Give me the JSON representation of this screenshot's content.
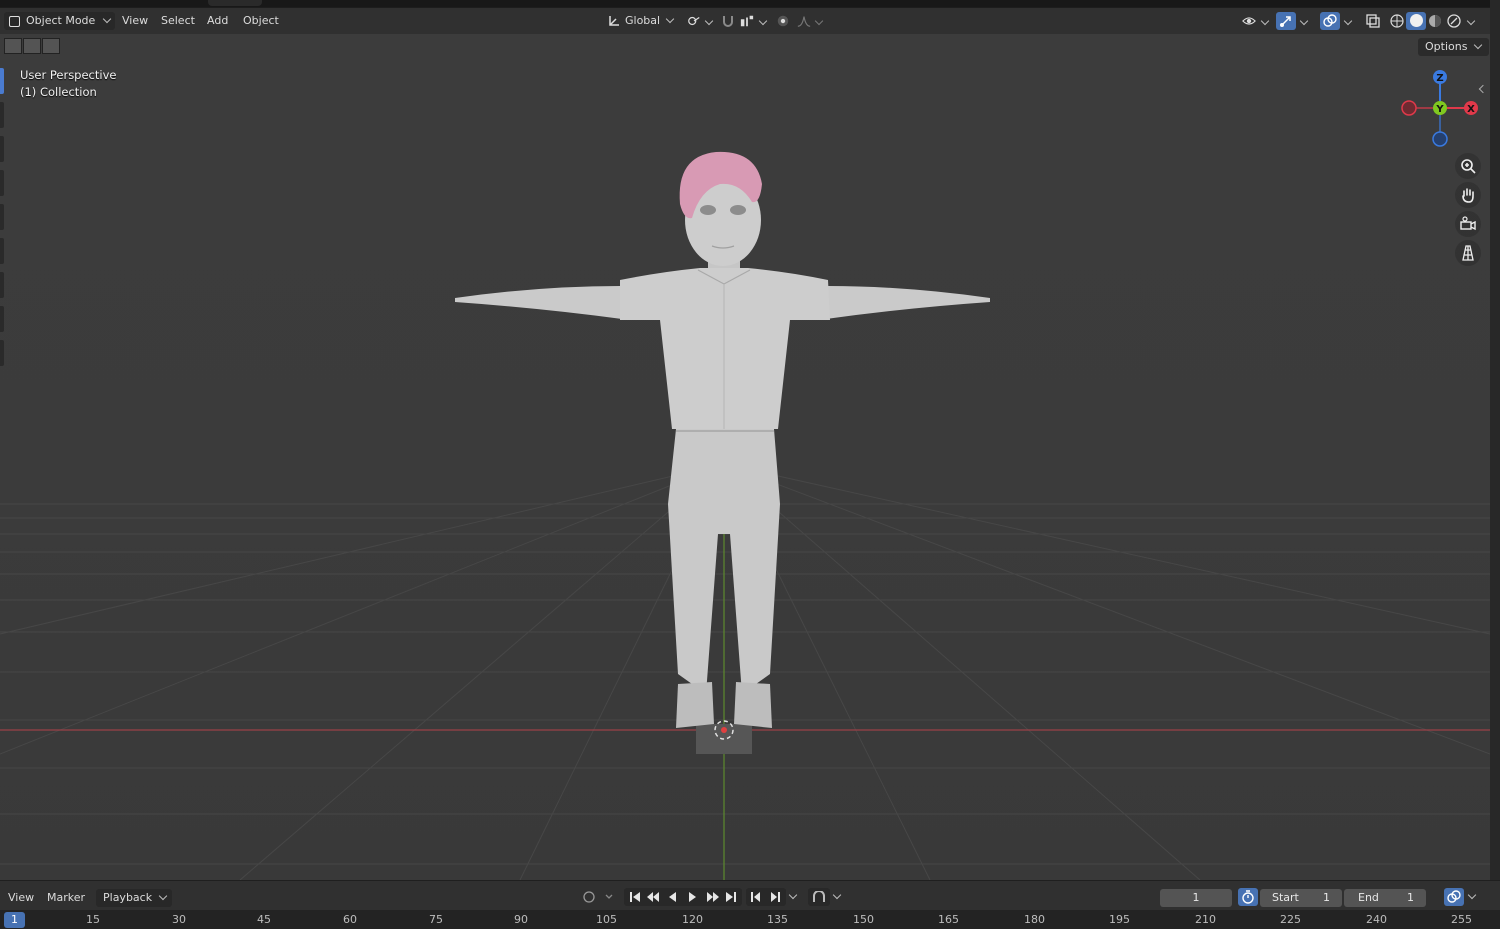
{
  "viewport_header": {
    "mode_label": "Object Mode",
    "menu": [
      "View",
      "Select",
      "Add",
      "Object"
    ],
    "transform_orientation": "Global"
  },
  "viewport": {
    "perspective_label": "User Perspective",
    "collection_label": "(1) Collection",
    "options_label": "Options",
    "gizmo_axes": {
      "x": "X",
      "y": "Y",
      "z": "Z"
    }
  },
  "timeline": {
    "menu": [
      "View",
      "Marker",
      "Playback"
    ],
    "current_frame": "1",
    "start_label": "Start",
    "start_value": "1",
    "end_label": "End",
    "end_value": "1",
    "ruler_current": "1",
    "ruler_ticks": [
      "15",
      "30",
      "45",
      "60",
      "75",
      "90",
      "105",
      "120",
      "135",
      "150",
      "165",
      "180",
      "195",
      "210",
      "225",
      "240",
      "255"
    ]
  },
  "colors": {
    "accent": "#4772b3",
    "x_axis": "#e0394a",
    "y_axis": "#80c820",
    "z_axis": "#3a7ae0",
    "hair": "#d89ab4",
    "body": "#cdcdcd"
  },
  "icons": {
    "mode": "object-mode-icon",
    "orientation": "transform-orientation-icon",
    "pivot": "pivot-point-icon",
    "snap": "snap-icon",
    "proportional": "proportional-editing-icon",
    "zoom": "zoom-icon",
    "pan": "hand-pan-icon",
    "camera": "camera-view-icon",
    "ortho": "orthographic-grid-icon"
  }
}
